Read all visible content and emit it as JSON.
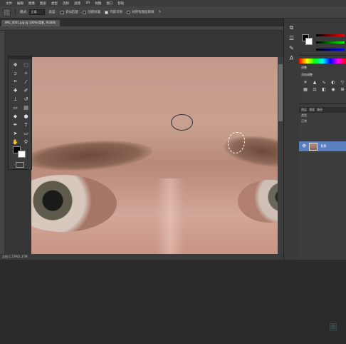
{
  "menubar": {
    "items": [
      "文件",
      "编辑",
      "图像",
      "图层",
      "类型",
      "选择",
      "滤镜",
      "3D",
      "视图",
      "窗口",
      "帮助"
    ]
  },
  "options": {
    "mode_label": "模式:",
    "mode_value": "正常",
    "type_label": "类型:",
    "near_label": "近似匹配",
    "texture_label": "创建纹理",
    "content_label": "内容识别",
    "sample_all_label": "对所有图层取样"
  },
  "tabs": [
    {
      "label": "IMG_0001.jpg @ 100%(背景, RGB/8)",
      "active": true
    }
  ],
  "status": {
    "zoom_text": "文档:1.37M/1.37M"
  },
  "right_panel": {
    "adjust_title": "调整",
    "adjust_subtitle": "添加调整",
    "layers_tab": "图层",
    "channels_tab": "通道",
    "paths_tab": "路径",
    "kind_label": "类型",
    "blend_value": "正常",
    "layer_name": "背景"
  },
  "watermark": "图"
}
